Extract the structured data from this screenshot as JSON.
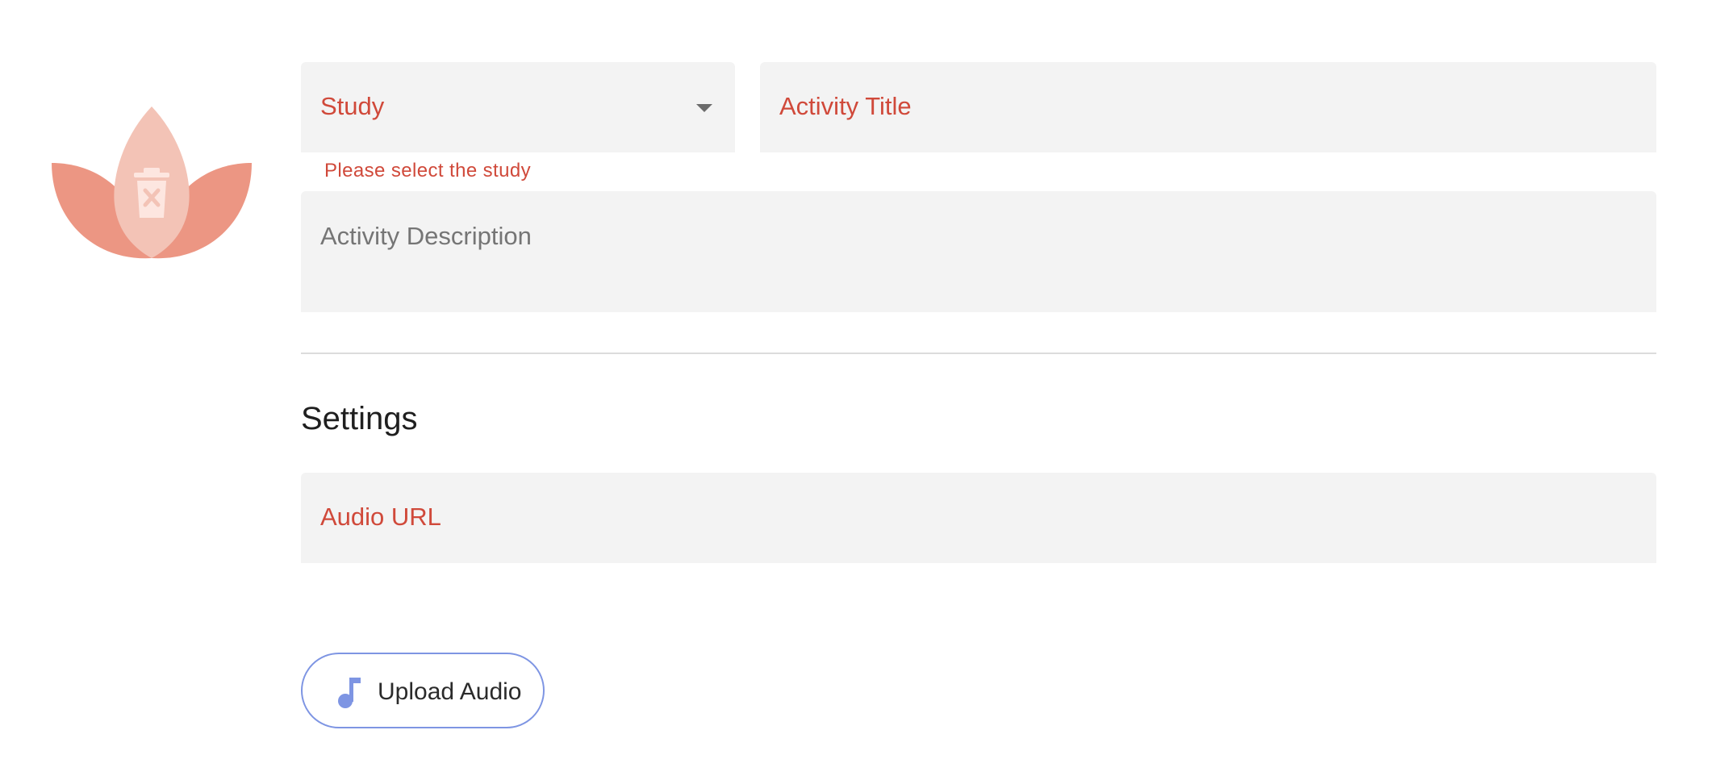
{
  "logo": {
    "icon": "lotus-delete-icon",
    "colors": {
      "outer_petals": "#ec9683",
      "center_petal": "#f3c3b6",
      "trash": "#fde6e0"
    }
  },
  "form": {
    "study": {
      "label": "Study",
      "error": "Please select the study"
    },
    "title": {
      "label": "Activity Title"
    },
    "description": {
      "label": "Activity Description"
    }
  },
  "settings": {
    "heading": "Settings",
    "audio_url": {
      "label": "Audio URL"
    },
    "upload_button": {
      "label": "Upload Audio",
      "icon": "music-note-icon"
    }
  },
  "colors": {
    "error": "#d0493a",
    "field_bg": "#f3f3f3",
    "accent": "#7e95e3"
  }
}
